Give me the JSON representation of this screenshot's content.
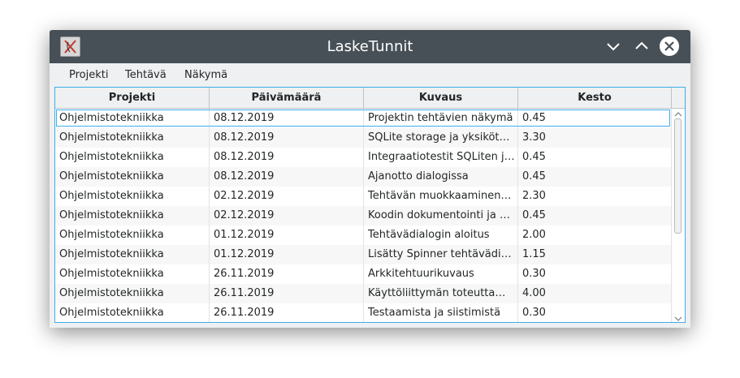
{
  "window": {
    "title": "LaskeTunnit"
  },
  "menu": {
    "items": [
      "Projekti",
      "Tehtävä",
      "Näkymä"
    ]
  },
  "table": {
    "columns": [
      "Projekti",
      "Päivämäärä",
      "Kuvaus",
      "Kesto"
    ],
    "rows": [
      [
        "Ohjelmistotekniikka",
        "08.12.2019",
        "Projektin tehtävien näkymä",
        "0.45"
      ],
      [
        "Ohjelmistotekniikka",
        "08.12.2019",
        "SQLite storage ja yksiköt…",
        "3.30"
      ],
      [
        "Ohjelmistotekniikka",
        "08.12.2019",
        "Integraatiotestit SQLiten j…",
        "0.45"
      ],
      [
        "Ohjelmistotekniikka",
        "08.12.2019",
        "Ajanotto dialogissa",
        "0.45"
      ],
      [
        "Ohjelmistotekniikka",
        "02.12.2019",
        "Tehtävän muokkaaminen…",
        "2.30"
      ],
      [
        "Ohjelmistotekniikka",
        "02.12.2019",
        "Koodin dokumentointi ja …",
        "0.45"
      ],
      [
        "Ohjelmistotekniikka",
        "01.12.2019",
        "Tehtävädialogin aloitus",
        "2.00"
      ],
      [
        "Ohjelmistotekniikka",
        "01.12.2019",
        "Lisätty Spinner tehtävädi…",
        "1.15"
      ],
      [
        "Ohjelmistotekniikka",
        "26.11.2019",
        "Arkkitehtuurikuvaus",
        "0.30"
      ],
      [
        "Ohjelmistotekniikka",
        "26.11.2019",
        "Käyttöliittymän toteutta…",
        "4.00"
      ],
      [
        "Ohjelmistotekniikka",
        "26.11.2019",
        "Testaamista ja siistimistä",
        "0.30"
      ]
    ],
    "selected_row": 0
  },
  "colors": {
    "titlebar": "#475057",
    "accent": "#3daee9",
    "window_bg": "#eff0f1"
  },
  "icons": {
    "app": "app-icon",
    "minimize": "chevron-down-icon",
    "maximize": "chevron-up-icon",
    "close": "close-icon"
  }
}
